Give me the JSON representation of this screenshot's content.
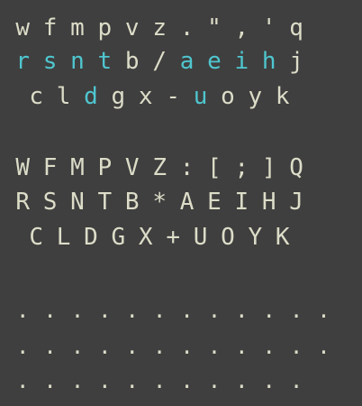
{
  "colors": {
    "background": "#3f3f3f",
    "key_text": "#dcdcc8",
    "home_key_text": "#4fc6cf"
  },
  "lower_layer": {
    "rows": [
      {
        "keys": [
          {
            "label": "w",
            "home": false
          },
          {
            "label": "f",
            "home": false
          },
          {
            "label": "m",
            "home": false
          },
          {
            "label": "p",
            "home": false
          },
          {
            "label": "v",
            "home": false
          },
          {
            "label": "z",
            "home": false
          },
          {
            "label": ".",
            "home": false
          },
          {
            "label": "\"",
            "home": false
          },
          {
            "label": ",",
            "home": false
          },
          {
            "label": "'",
            "home": false
          },
          {
            "label": "q",
            "home": false
          }
        ]
      },
      {
        "keys": [
          {
            "label": "r",
            "home": true
          },
          {
            "label": "s",
            "home": true
          },
          {
            "label": "n",
            "home": true
          },
          {
            "label": "t",
            "home": true
          },
          {
            "label": "b",
            "home": false
          },
          {
            "label": "/",
            "home": false
          },
          {
            "label": "a",
            "home": true
          },
          {
            "label": "e",
            "home": true
          },
          {
            "label": "i",
            "home": true
          },
          {
            "label": "h",
            "home": true
          },
          {
            "label": "j",
            "home": false
          }
        ]
      },
      {
        "keys": [
          {
            "label": "c",
            "home": false
          },
          {
            "label": "l",
            "home": false
          },
          {
            "label": "d",
            "home": true
          },
          {
            "label": "g",
            "home": false
          },
          {
            "label": "x",
            "home": false
          },
          {
            "label": "-",
            "home": false
          },
          {
            "label": "u",
            "home": true
          },
          {
            "label": "o",
            "home": false
          },
          {
            "label": "y",
            "home": false
          },
          {
            "label": "k",
            "home": false
          }
        ]
      }
    ]
  },
  "upper_layer": {
    "rows": [
      {
        "keys": [
          {
            "label": "W"
          },
          {
            "label": "F"
          },
          {
            "label": "M"
          },
          {
            "label": "P"
          },
          {
            "label": "V"
          },
          {
            "label": "Z"
          },
          {
            "label": ":"
          },
          {
            "label": "["
          },
          {
            "label": ";"
          },
          {
            "label": "]"
          },
          {
            "label": "Q"
          }
        ]
      },
      {
        "keys": [
          {
            "label": "R"
          },
          {
            "label": "S"
          },
          {
            "label": "N"
          },
          {
            "label": "T"
          },
          {
            "label": "B"
          },
          {
            "label": "*"
          },
          {
            "label": "A"
          },
          {
            "label": "E"
          },
          {
            "label": "I"
          },
          {
            "label": "H"
          },
          {
            "label": "J"
          }
        ]
      },
      {
        "keys": [
          {
            "label": "C"
          },
          {
            "label": "L"
          },
          {
            "label": "D"
          },
          {
            "label": "G"
          },
          {
            "label": "X"
          },
          {
            "label": "+"
          },
          {
            "label": "U"
          },
          {
            "label": "O"
          },
          {
            "label": "Y"
          },
          {
            "label": "K"
          }
        ]
      }
    ]
  },
  "dot_layer": {
    "rows": [
      {
        "keys": [
          {
            "label": "."
          },
          {
            "label": "."
          },
          {
            "label": "."
          },
          {
            "label": "."
          },
          {
            "label": "."
          },
          {
            "label": "."
          },
          {
            "label": "."
          },
          {
            "label": "."
          },
          {
            "label": "."
          },
          {
            "label": "."
          },
          {
            "label": "."
          },
          {
            "label": "."
          }
        ]
      },
      {
        "keys": [
          {
            "label": "."
          },
          {
            "label": "."
          },
          {
            "label": "."
          },
          {
            "label": "."
          },
          {
            "label": "."
          },
          {
            "label": "."
          },
          {
            "label": "."
          },
          {
            "label": "."
          },
          {
            "label": "."
          },
          {
            "label": "."
          },
          {
            "label": "."
          },
          {
            "label": "."
          }
        ]
      },
      {
        "keys": [
          {
            "label": "."
          },
          {
            "label": "."
          },
          {
            "label": "."
          },
          {
            "label": "."
          },
          {
            "label": "."
          },
          {
            "label": "."
          },
          {
            "label": "."
          },
          {
            "label": "."
          },
          {
            "label": "."
          },
          {
            "label": "."
          },
          {
            "label": "."
          }
        ]
      }
    ]
  }
}
